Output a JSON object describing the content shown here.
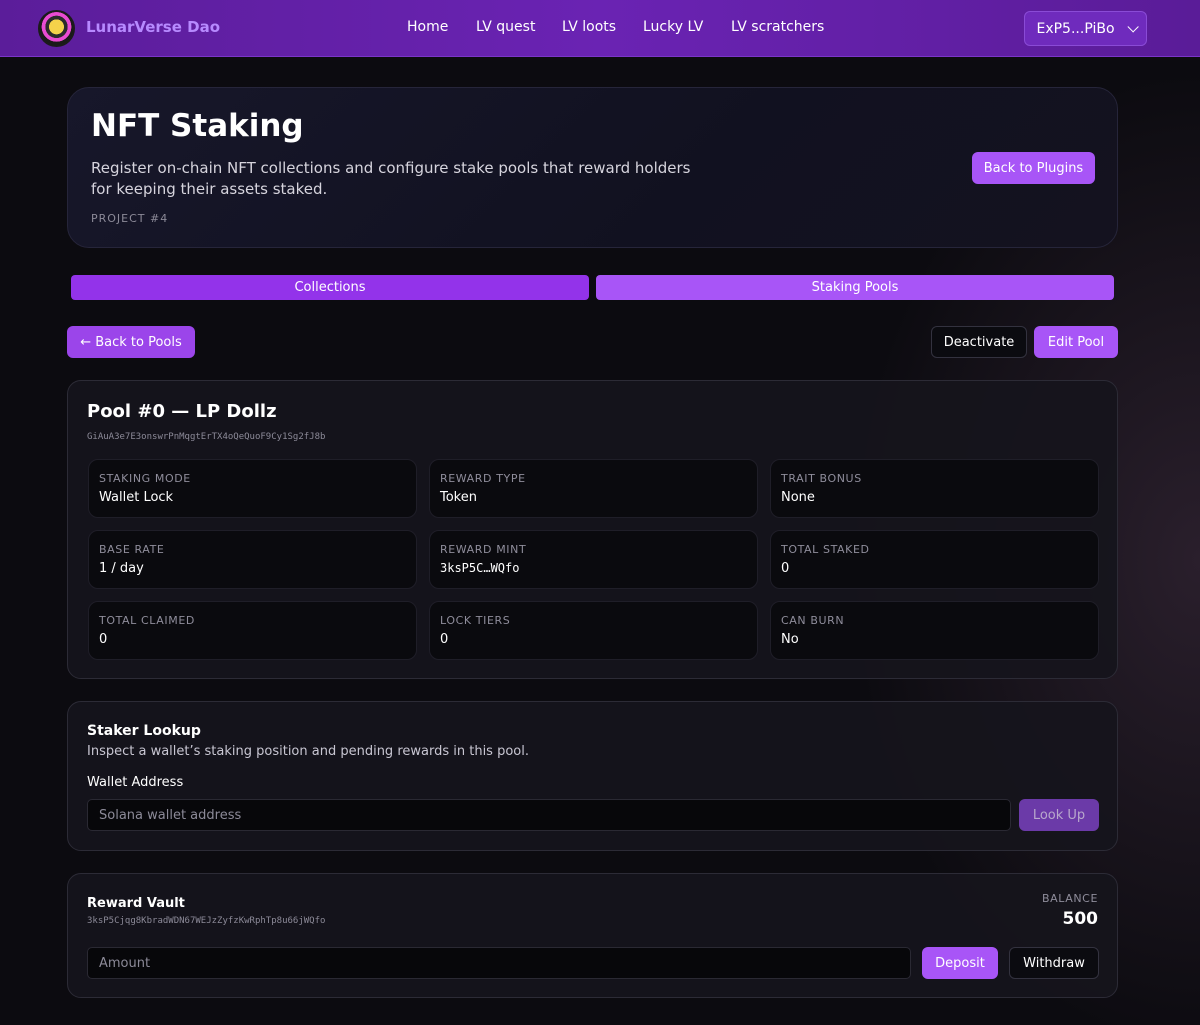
{
  "header": {
    "brand": "LunarVerse Dao",
    "nav": [
      "Home",
      "LV quest",
      "LV loots",
      "Lucky LV",
      "LV scratchers"
    ],
    "wallet": "ExP5...PiBo"
  },
  "hero": {
    "title": "NFT Staking",
    "description": "Register on-chain NFT collections and configure stake pools that reward holders for keeping their assets staked.",
    "project": "PROJECT #4",
    "back_button": "Back to Plugins"
  },
  "tabs": [
    "Collections",
    "Staking Pools"
  ],
  "actions": {
    "back_to_pools": "← Back to Pools",
    "deactivate": "Deactivate",
    "edit_pool": "Edit Pool"
  },
  "pool": {
    "title": "Pool #0 — LP Dollz",
    "address": "GiAuA3e7E3onswrPnMqgtErTX4oQeQuoF9Cy1Sg2fJ8b",
    "stats": [
      {
        "label": "STAKING MODE",
        "value": "Wallet Lock"
      },
      {
        "label": "REWARD TYPE",
        "value": "Token"
      },
      {
        "label": "TRAIT BONUS",
        "value": "None"
      },
      {
        "label": "BASE RATE",
        "value": "1 / day"
      },
      {
        "label": "REWARD MINT",
        "value": "3ksP5C…WQfo"
      },
      {
        "label": "TOTAL STAKED",
        "value": "0"
      },
      {
        "label": "TOTAL CLAIMED",
        "value": "0"
      },
      {
        "label": "LOCK TIERS",
        "value": "0"
      },
      {
        "label": "CAN BURN",
        "value": "No"
      }
    ]
  },
  "staker_lookup": {
    "title": "Staker Lookup",
    "subtitle": "Inspect a wallet’s staking position and pending rewards in this pool.",
    "field_label": "Wallet Address",
    "placeholder": "Solana wallet address",
    "button": "Look Up"
  },
  "vault": {
    "title": "Reward Vault",
    "address": "3ksP5Cjqg8KbradWDN67WEJzZyfzKwRphTp8u66jWQfo",
    "balance_label": "BALANCE",
    "balance": "500",
    "amount_placeholder": "Amount",
    "deposit": "Deposit",
    "withdraw": "Withdraw"
  }
}
